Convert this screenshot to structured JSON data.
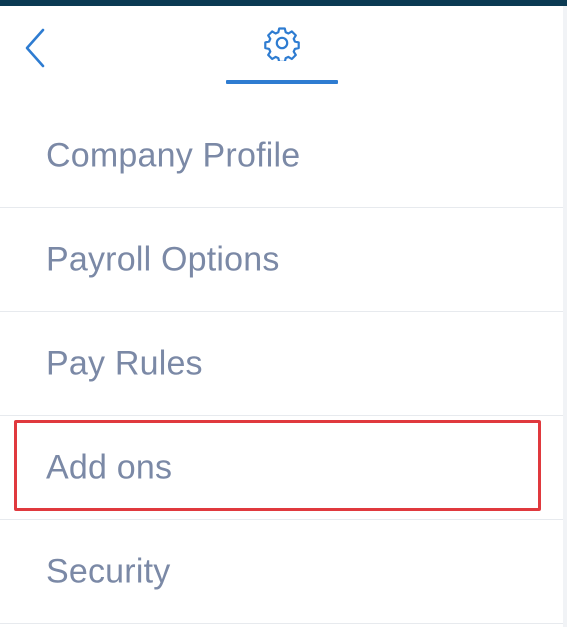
{
  "header": {
    "back_icon": "chevron-left-icon",
    "settings_icon": "gear-icon",
    "accent_color": "#2e7cd1"
  },
  "menu": {
    "items": [
      {
        "label": "Company Profile"
      },
      {
        "label": "Payroll Options"
      },
      {
        "label": "Pay Rules"
      },
      {
        "label": "Add ons",
        "highlighted": true
      },
      {
        "label": "Security"
      }
    ]
  },
  "colors": {
    "top_bar": "#0b3a53",
    "label_text": "#7b89a6",
    "highlight_border": "#e0393e"
  }
}
